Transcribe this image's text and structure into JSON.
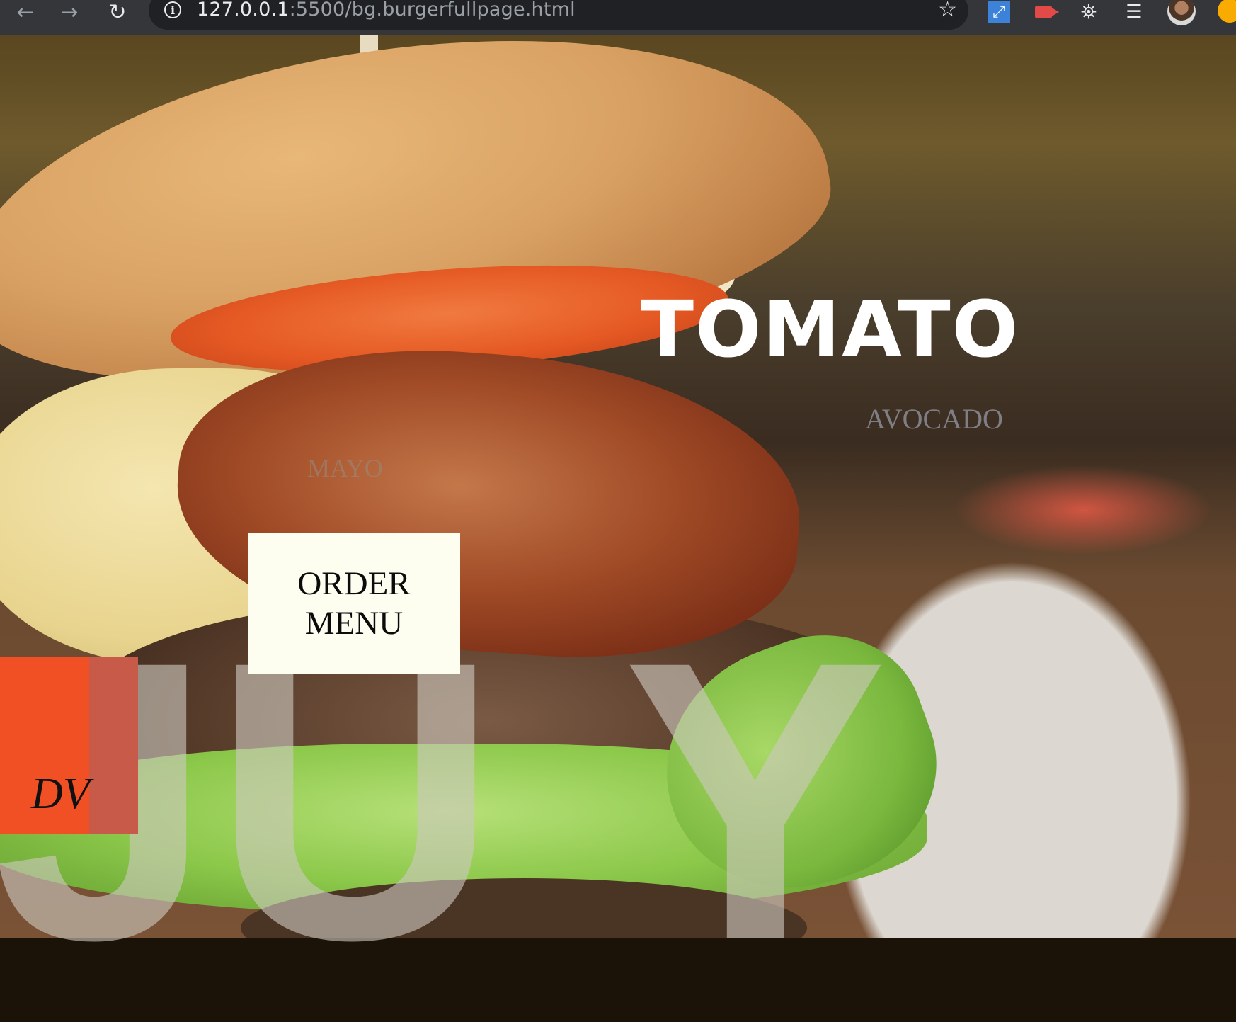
{
  "browser": {
    "url_host": "127.0.0.1",
    "url_path": ":5500/bg.burgerfullpage.html",
    "back_icon": "arrow-left",
    "forward_icon": "arrow-right",
    "reload_icon": "reload",
    "info_icon": "info",
    "bookmark_icon": "star",
    "extensions": [
      "resize-extension",
      "screen-recorder-extension",
      "puzzle-extensions",
      "media-controls"
    ],
    "profile": "avatar"
  },
  "page": {
    "heading": "TOMATO",
    "secondary_word": "AVOCADO",
    "tertiary_word": "MAYO",
    "order_button": {
      "line1": "ORDER",
      "line2": "MENU"
    },
    "logo_text": "DV",
    "colors": {
      "logo_orange": "#f05024",
      "logo_band": "#c85a4a",
      "order_button_bg": "#fdfdf0",
      "heading_color": "#ffffff"
    }
  }
}
